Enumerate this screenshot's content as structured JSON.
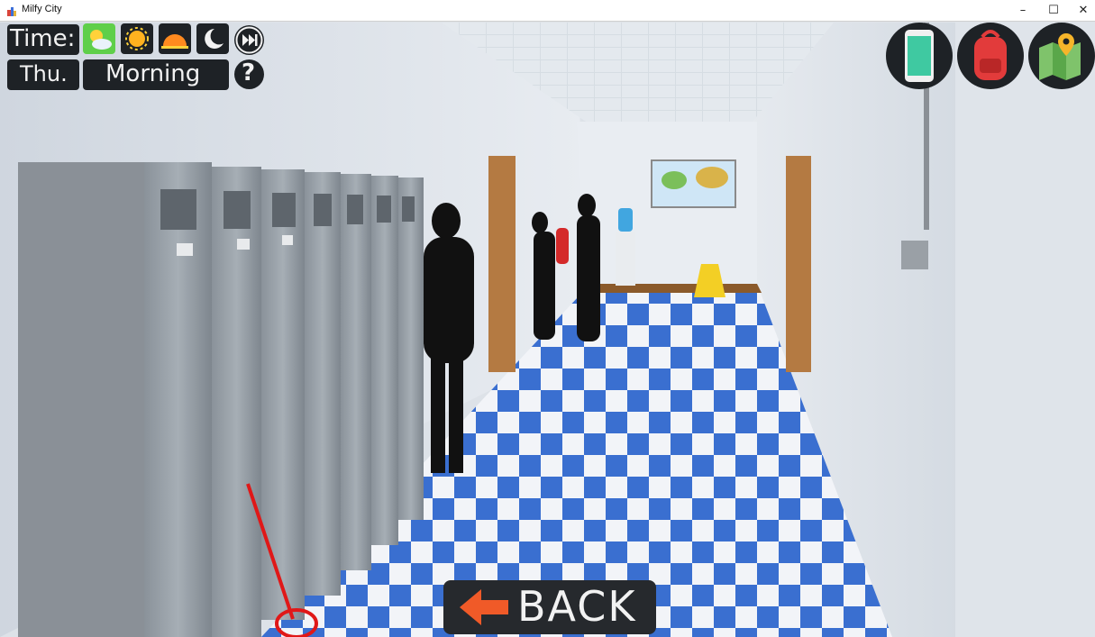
{
  "window": {
    "title": "Milfy City",
    "minimize_glyph": "–",
    "maximize_glyph": "☐",
    "close_glyph": "✕"
  },
  "hud": {
    "time_label": "Time:",
    "day_label": "Thu.",
    "period_label": "Morning",
    "help_glyph": "?",
    "time_of_day_buttons": [
      {
        "icon": "morning-sun-cloud-icon",
        "active": true
      },
      {
        "icon": "noon-sun-icon",
        "active": false
      },
      {
        "icon": "sunset-icon",
        "active": false
      },
      {
        "icon": "night-moon-icon",
        "active": false
      }
    ],
    "skip_icon": "fast-forward-icon"
  },
  "top_right_buttons": [
    {
      "icon": "phone-icon"
    },
    {
      "icon": "backpack-icon"
    },
    {
      "icon": "map-icon"
    }
  ],
  "back_button": {
    "label": "BACK",
    "icon": "arrow-left-icon"
  },
  "colors": {
    "hud_bg": "#1e2226",
    "active_green": "#5fcf4a",
    "floor_blue": "#3a6fd0",
    "floor_white": "#f2f4f8",
    "arrow_orange": "#f05a28",
    "annotation_red": "#e01818"
  }
}
